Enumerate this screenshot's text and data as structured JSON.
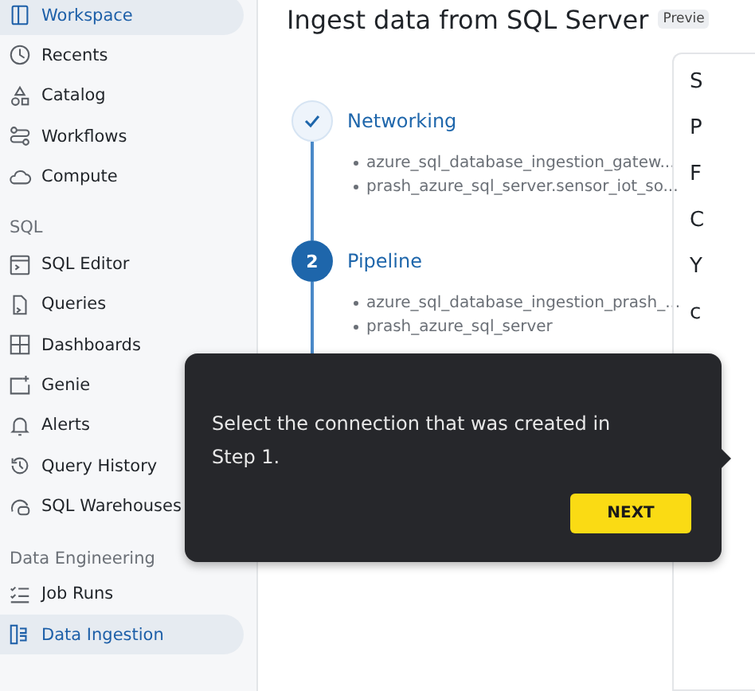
{
  "sidebar": {
    "sections": [
      {
        "items": [
          {
            "label": "Workspace",
            "selected": true
          },
          {
            "label": "Recents",
            "selected": false
          },
          {
            "label": "Catalog",
            "selected": false
          },
          {
            "label": "Workflows",
            "selected": false
          },
          {
            "label": "Compute",
            "selected": false
          }
        ]
      },
      {
        "heading": "SQL",
        "items": [
          {
            "label": "SQL Editor",
            "selected": false
          },
          {
            "label": "Queries",
            "selected": false
          },
          {
            "label": "Dashboards",
            "selected": false
          },
          {
            "label": "Genie",
            "selected": false
          },
          {
            "label": "Alerts",
            "selected": false
          },
          {
            "label": "Query History",
            "selected": false
          },
          {
            "label": "SQL Warehouses",
            "selected": false
          }
        ]
      },
      {
        "heading": "Data Engineering",
        "items": [
          {
            "label": "Job Runs",
            "selected": false
          },
          {
            "label": "Data Ingestion",
            "selected": true
          }
        ]
      }
    ]
  },
  "page": {
    "title": "Ingest data from SQL Server",
    "badge": "Previe"
  },
  "steps": [
    {
      "title": "Networking",
      "done": true,
      "details": [
        "azure_sql_database_ingestion_gatew...",
        "prash_azure_sql_server.sensor_iot_so..."
      ]
    },
    {
      "number": "2",
      "title": "Pipeline",
      "done": false,
      "details": [
        "azure_sql_database_ingestion_prash_...",
        "prash_azure_sql_server"
      ]
    }
  ],
  "panel": {
    "texts": [
      "S",
      "P",
      "F",
      "C",
      "Y",
      "c"
    ]
  },
  "tooltip": {
    "text": "Select the connection that was created in Step 1.",
    "button": "NEXT"
  }
}
